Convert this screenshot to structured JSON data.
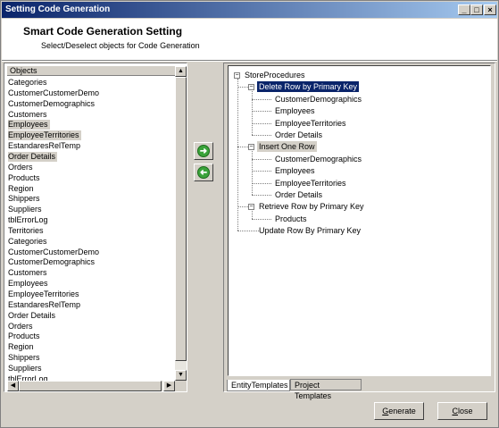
{
  "window": {
    "title": "Setting Code Generation"
  },
  "header": {
    "title": "Smart Code Generation Setting",
    "subtitle": "Select/Deselect objects for Code Generation"
  },
  "objects": {
    "header": "Objects",
    "items": [
      {
        "label": "Categories",
        "selected": false
      },
      {
        "label": "CustomerCustomerDemo",
        "selected": false
      },
      {
        "label": "CustomerDemographics",
        "selected": false
      },
      {
        "label": "Customers",
        "selected": false
      },
      {
        "label": "Employees",
        "selected": true
      },
      {
        "label": "EmployeeTerritories",
        "selected": true
      },
      {
        "label": "EstandaresRelTemp",
        "selected": false
      },
      {
        "label": "Order Details",
        "selected": true
      },
      {
        "label": "Orders",
        "selected": false
      },
      {
        "label": "Products",
        "selected": false
      },
      {
        "label": "Region",
        "selected": false
      },
      {
        "label": "Shippers",
        "selected": false
      },
      {
        "label": "Suppliers",
        "selected": false
      },
      {
        "label": "tblErrorLog",
        "selected": false
      },
      {
        "label": "Territories",
        "selected": false
      },
      {
        "label": "Categories",
        "selected": false
      },
      {
        "label": "CustomerCustomerDemo",
        "selected": false
      },
      {
        "label": "CustomerDemographics",
        "selected": false
      },
      {
        "label": "Customers",
        "selected": false
      },
      {
        "label": "Employees",
        "selected": false
      },
      {
        "label": "EmployeeTerritories",
        "selected": false
      },
      {
        "label": "EstandaresRelTemp",
        "selected": false
      },
      {
        "label": "Order Details",
        "selected": false
      },
      {
        "label": "Orders",
        "selected": false
      },
      {
        "label": "Products",
        "selected": false
      },
      {
        "label": "Region",
        "selected": false
      },
      {
        "label": "Shippers",
        "selected": false
      },
      {
        "label": "Suppliers",
        "selected": false
      },
      {
        "label": "tblErrorLog",
        "selected": false
      }
    ]
  },
  "tree": {
    "root": "StoreProcedures",
    "nodes": [
      {
        "label": "Delete Row by Primary Key",
        "children": [
          "CustomerDemographics",
          "Employees",
          "EmployeeTerritories",
          "Order Details"
        ]
      },
      {
        "label": "Insert One Row",
        "children": [
          "CustomerDemographics",
          "Employees",
          "EmployeeTerritories",
          "Order Details"
        ]
      },
      {
        "label": "Retrieve Row by Primary Key",
        "children": [
          "Products"
        ]
      },
      {
        "label": "Update Row By Primary Key",
        "children": []
      }
    ]
  },
  "tabs": [
    {
      "label": "EntityTemplates",
      "active": true
    },
    {
      "label": "Project Templates",
      "active": false
    }
  ],
  "buttons": {
    "generate": "Generate",
    "close": "Close"
  },
  "icons": {
    "add": "arrow-right-icon",
    "remove": "arrow-left-icon",
    "accent": "#3aa33a"
  }
}
